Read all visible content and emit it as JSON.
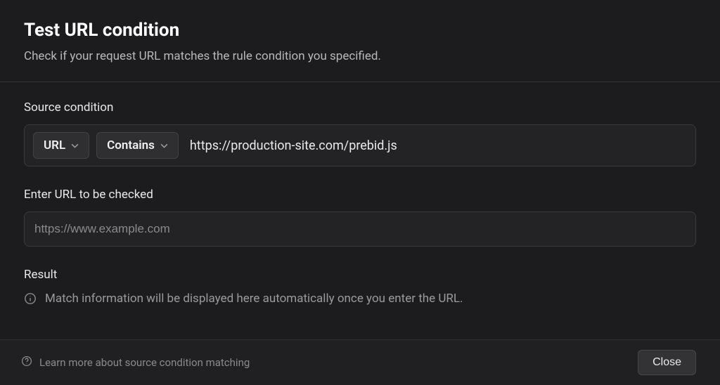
{
  "header": {
    "title": "Test URL condition",
    "subtitle": "Check if your request URL matches the rule condition you specified."
  },
  "source": {
    "label": "Source condition",
    "type_dropdown": "URL",
    "match_dropdown": "Contains",
    "value": "https://production-site.com/prebid.js"
  },
  "check": {
    "label": "Enter URL to be checked",
    "placeholder": "https://www.example.com",
    "value": ""
  },
  "result": {
    "label": "Result",
    "placeholder_text": "Match information will be displayed here automatically once you enter the URL."
  },
  "footer": {
    "learn_link": "Learn more about source condition matching",
    "close_label": "Close"
  }
}
